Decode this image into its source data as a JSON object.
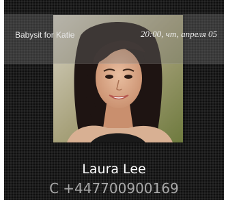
{
  "reminder": {
    "title": "Babysit for Katie",
    "time": "20:00, чт, апреля 05"
  },
  "contact": {
    "photo_icon": "contact-photo",
    "name": "Laura Lee",
    "number_type": "C",
    "number": "+447700900169"
  },
  "colors": {
    "background": "#1c1c1c",
    "name_text": "#ffffff",
    "number_text": "#a9a9a9"
  }
}
